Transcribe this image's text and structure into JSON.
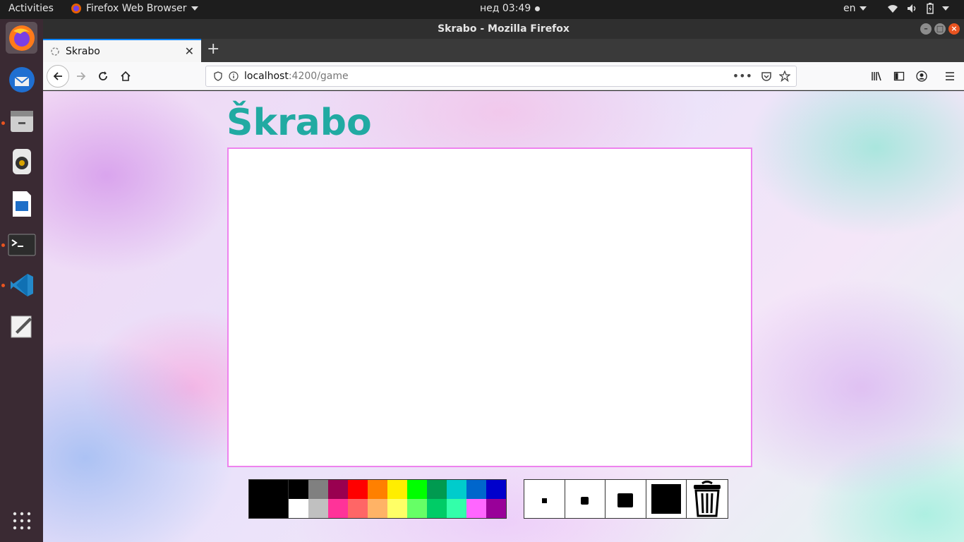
{
  "os": {
    "activities": "Activities",
    "app_menu": "Firefox Web Browser",
    "clock": "нед 03:49",
    "keyboard_layout": "en"
  },
  "window": {
    "title": "Skrabo - Mozilla Firefox"
  },
  "browser": {
    "tab_title": "Skrabo",
    "url_host": "localhost",
    "url_path": ":4200/game"
  },
  "page": {
    "title": "Škrabo",
    "canvas_border_color": "#ee82ee",
    "title_color": "#21aaa2",
    "current_color": "#000000",
    "palette_top": [
      "#000000",
      "#808080",
      "#990050",
      "#ff0000",
      "#ff8000",
      "#ffee00",
      "#00ff00",
      "#009a50",
      "#00cccc",
      "#0066cc",
      "#0000cc"
    ],
    "palette_bottom": [
      "#ffffff",
      "#c0c0c0",
      "#ff3399",
      "#ff6666",
      "#ffb366",
      "#ffff66",
      "#66ff66",
      "#00cc66",
      "#33ffaa",
      "#ff66ff",
      "#990099"
    ],
    "brush_sizes": [
      "small-brush-icon",
      "medium-brush-icon",
      "large-brush-icon",
      "xlarge-brush-icon"
    ],
    "trash": "trash-icon"
  }
}
